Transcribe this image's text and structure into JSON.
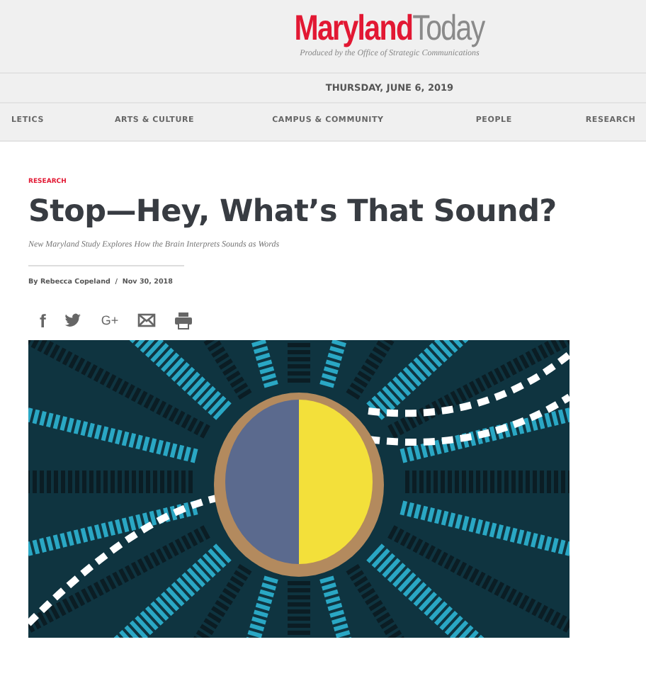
{
  "masthead": {
    "logo_primary": "Maryland",
    "logo_secondary": "Today",
    "tagline": "Produced by the Office of Strategic Communications",
    "date": "THURSDAY, JUNE 6, 2019"
  },
  "nav": [
    "LETICS",
    "ARTS & CULTURE",
    "CAMPUS & COMMUNITY",
    "PEOPLE",
    "RESEARCH"
  ],
  "article": {
    "category": "RESEARCH",
    "title": "Stop—Hey, What’s That Sound?",
    "subtitle": "New Maryland Study Explores How the Brain Interprets Sounds as Words",
    "byline": "By Rebecca Copeland  /  Nov 30, 2018"
  },
  "share": [
    {
      "kind": "facebook",
      "label": "f"
    },
    {
      "kind": "twitter"
    },
    {
      "kind": "googleplus",
      "label": "G+"
    },
    {
      "kind": "email"
    },
    {
      "kind": "print"
    }
  ]
}
